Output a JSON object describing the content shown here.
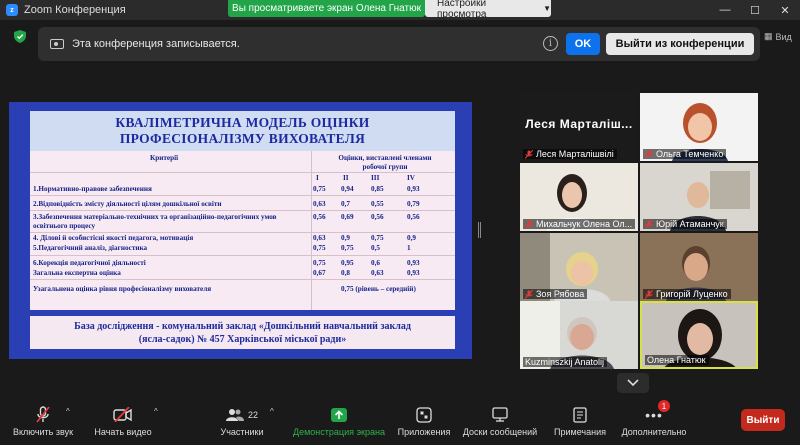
{
  "window": {
    "title": "Zoom Конференция",
    "share_banner": "Вы просматриваете экран Олена Гнатюк",
    "view_settings": "Настройки просмотра",
    "view_toggle": "Вид"
  },
  "recording": {
    "message": "Эта конференция записывается.",
    "ok": "OK",
    "leave": "Выйти из конференции"
  },
  "slide": {
    "title_line1": "КВАЛІМЕТРИЧНА МОДЕЛЬ ОЦІНКИ",
    "title_line2": "ПРОФЕСІОНАЛІЗМУ ВИХОВАТЕЛЯ",
    "col_criteria": "Критерії",
    "col_scores_line1": "Оцінки, виставлені  членами",
    "col_scores_line2": "робочої групи",
    "roman": [
      "I",
      "II",
      "III",
      "IV"
    ],
    "rows": [
      {
        "label": "1.Нормативно-правове забезпечення",
        "v": [
          "0,75",
          "0,94",
          "0,85",
          "0,93"
        ]
      },
      {
        "label": "2.Відповідність змісту діяльності цілям дошкільної освіти",
        "v": [
          "0,63",
          "0,7",
          "0,55",
          "0,79"
        ]
      },
      {
        "label": "3.Забезпечення матеріально-технічних та організаційно-педагогічних умов освітнього процесу",
        "v": [
          "0,56",
          "0,69",
          "0,56",
          "0,56"
        ]
      },
      {
        "label": "4. Ділові й особистісні якості педагога, мотивація",
        "v": [
          "0,63",
          "0,9",
          "0,75",
          "0,9"
        ]
      },
      {
        "label": "5.Педагогічний аналіз, діагностика",
        "v": [
          "0,75",
          "0,75",
          "0,5",
          "1"
        ]
      },
      {
        "label": "6.Корекція педагогічної діяльності",
        "v": [
          "0,75",
          "0,95",
          "0,6",
          "0,93"
        ]
      },
      {
        "label": "Загальна експертна оцінка",
        "v": [
          "0,67",
          "0,8",
          "0,63",
          "0,93"
        ]
      }
    ],
    "summary_label": "Узагальнена оцінка рівня професіоналізму вихователя",
    "summary_value": "0,75 (рівень – середній)",
    "footer_line1": "База дослідження - комунальний заклад «Дошкільний навчальний заклад",
    "footer_line2": "(ясла-садок) № 457 Харківської міської ради»"
  },
  "participants": [
    {
      "name": "Леся Марталішвілі",
      "display": "Леся  Марталіш...",
      "muted": true
    },
    {
      "name": "Ольга Темченко",
      "muted": true
    },
    {
      "name": "Михальчук Олена Ол...",
      "muted": true
    },
    {
      "name": "Юрій Атаманчук",
      "muted": true
    },
    {
      "name": "Зоя Рябова",
      "muted": true
    },
    {
      "name": "Григорій Луценко",
      "muted": true
    },
    {
      "name": "Kuzminszkij Anatolij",
      "muted": false
    },
    {
      "name": "Олена Гнатюк",
      "muted": false,
      "active": true
    }
  ],
  "toolbar": {
    "mute": "Включить звук",
    "video": "Начать видео",
    "participants": "Участники",
    "participants_count": "22",
    "share": "Демонстрация экрана",
    "apps": "Приложения",
    "whiteboards": "Доски сообщений",
    "notes": "Примечания",
    "more": "Дополнительно",
    "more_badge": "1",
    "end": "Выйти"
  },
  "colors": {
    "accent_blue": "#0e72ed",
    "share_green": "#21a548",
    "end_red": "#c4291e",
    "active_speaker": "#d6e24a",
    "slide_blue": "#2b3fb5"
  }
}
